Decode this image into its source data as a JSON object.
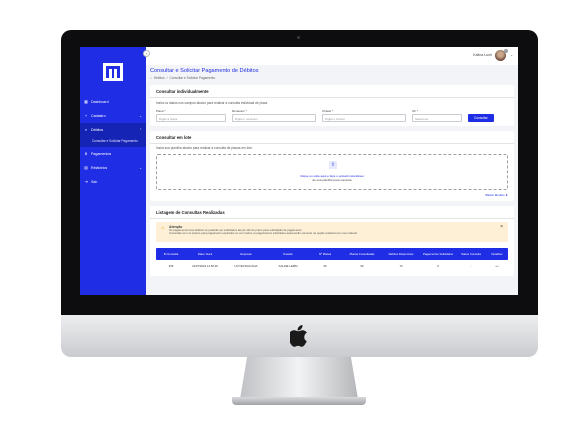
{
  "topbar": {
    "user_name": "Kalina Lumi"
  },
  "sidebar": {
    "items": [
      {
        "label": "Dashboard",
        "icon": "grid-icon"
      },
      {
        "label": "Cadastro",
        "icon": "plus-icon",
        "chevron": "⌄"
      },
      {
        "label": "Débitos",
        "icon": "search-icon",
        "chevron": "⌃"
      },
      {
        "label": "Pagamentos",
        "icon": "dollar-icon"
      },
      {
        "label": "Relatórios",
        "icon": "report-icon",
        "chevron": "⌄"
      },
      {
        "label": "Sair",
        "icon": "logout-icon"
      }
    ],
    "subitem": "Consultar e Solicitar Pagamento"
  },
  "page": {
    "title": "Consultar e Solicitar Pagamento de Débitos",
    "breadcrumb": [
      "Débitos",
      "Consultar e Solicitar Pagamento"
    ]
  },
  "individual": {
    "title": "Consultar individualmente",
    "desc": "Insira os dados nos campos abaixo para realizar a consulta individual de placa.",
    "fields": [
      {
        "label": "Placa *",
        "placeholder": "Digite a placa"
      },
      {
        "label": "Renavam *",
        "placeholder": "Digite o renavam"
      },
      {
        "label": "Chassi *",
        "placeholder": "Digite o chassi"
      },
      {
        "label": "UF *",
        "placeholder": "Selecione"
      }
    ],
    "button": "Consultar"
  },
  "batch": {
    "title": "Consultar em lote",
    "desc": "Insira sua planilha abaixo para realizar a consulta de placas em lote.",
    "drop_text": "Clique ou solte aqui e faça o upload instantâneo",
    "drop_sub": "de sua planilha para consulta",
    "sample_link": "Baixar Modelo ⬇"
  },
  "listing": {
    "title": "Listagem de Consultas Realizadas",
    "alert_title": "Atenção",
    "alert_lines": [
      "Os pagamentos dos débitos só poderão ser solicitados até às 11h do prazo para solicitação de pagamento.",
      "Consultas com os prazos para pagamento expirados ou com todos os pagamentos solicitados aparecerão somente na opção relatórios do menu lateral."
    ],
    "columns": [
      "ID Consulta",
      "Data / Hora",
      "Empresa",
      "Usuário",
      "Nº Placas",
      "Placas Consultadas",
      "Débitos Disponíveis",
      "Pagamentos Solicitados",
      "Status Consulta",
      "Detalhes"
    ],
    "rows": [
      [
        "256",
        "22/07/2022 14:52:00",
        "LM TECNOLOGIA",
        "KALINE LEMM",
        "90",
        "90",
        "72",
        "6",
        "◌",
        "•••"
      ]
    ]
  }
}
